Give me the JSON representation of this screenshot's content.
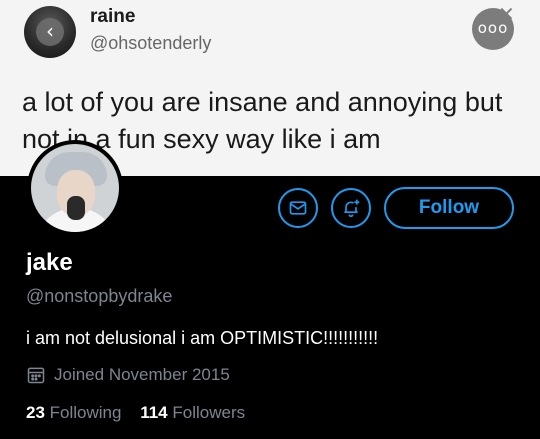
{
  "tweet": {
    "author_name": "raine",
    "author_handle": "@ohsotenderly",
    "back_icon": "chevron-left-icon",
    "more_icon": "more-horizontal-icon",
    "more_glyph": "ooo",
    "close_glyph": "✕",
    "text": "a lot of you are insane and annoying but not in a fun sexy way like i am"
  },
  "profile": {
    "display_name": "jake",
    "handle": "@nonstopbydrake",
    "bio": "i am not delusional i am OPTIMISTIC!!!!!!!!!!!",
    "joined": "Joined November 2015",
    "following_count": "23",
    "following_label": "Following",
    "followers_count": "114",
    "followers_label": "Followers",
    "follow_button": "Follow",
    "accent_color": "#1d9bf0"
  }
}
